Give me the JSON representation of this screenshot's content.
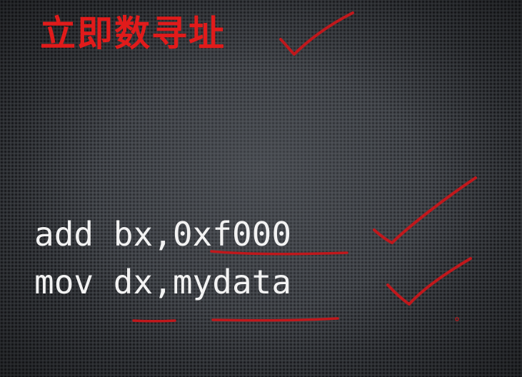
{
  "slide": {
    "title": "立即数寻址",
    "code_lines": [
      "add bx,0xf000",
      "mov dx,mydata"
    ]
  },
  "colors": {
    "background": "#3a3d42",
    "title": "#e11b1b",
    "code_text": "#f2f2f2",
    "annotation_ink": "#c0181c"
  }
}
